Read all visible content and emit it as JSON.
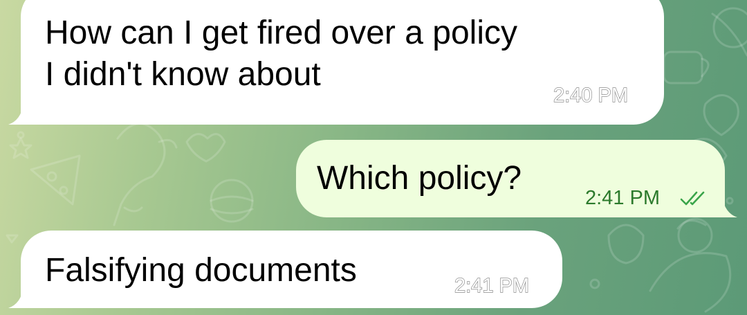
{
  "chat": {
    "messages": [
      {
        "direction": "incoming",
        "lines": [
          "How can I get fired over a policy",
          "I didn't know about"
        ],
        "time": "2:40 PM"
      },
      {
        "direction": "outgoing",
        "text": "Which policy?",
        "time": "2:41 PM",
        "status_icon": "double-check-icon"
      },
      {
        "direction": "incoming",
        "text": "Falsifying documents",
        "time": "2:41 PM"
      }
    ]
  },
  "colors": {
    "incoming_bubble": "#ffffff",
    "outgoing_bubble": "#effedd",
    "outgoing_time": "#2c7a2c",
    "read_ticks": "#3aa54a"
  }
}
